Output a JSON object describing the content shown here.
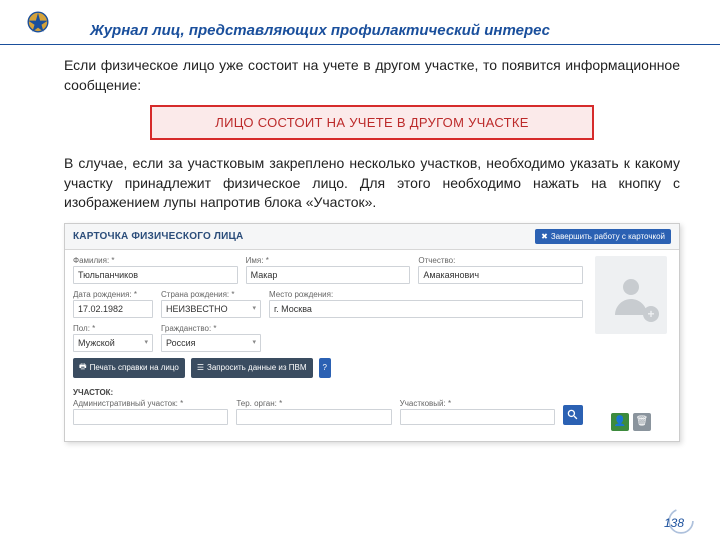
{
  "page": {
    "title": "Журнал лиц, представляющих профилактический интерес",
    "number": "138"
  },
  "paragraphs": {
    "p1": "Если физическое лицо уже состоит на учете в другом участке, то появится информационное сообщение:",
    "alert": "ЛИЦО СОСТОИТ НА УЧЕТЕ В ДРУГОМ УЧАСТКЕ",
    "p2": "В случае, если за участковым закреплено несколько участков, необходимо указать к какому участку принадлежит физическое лицо. Для этого необходимо нажать на кнопку с изображением лупы напротив блока «Участок»."
  },
  "card": {
    "header_title": "КАРТОЧКА ФИЗИЧЕСКОГО ЛИЦА",
    "close_button": "Завершить работу с карточкой",
    "labels": {
      "surname": "Фамилия: *",
      "name": "Имя: *",
      "patronymic": "Отчество:",
      "dob": "Дата рождения: *",
      "country": "Страна рождения: *",
      "birthplace": "Место рождения:",
      "sex": "Пол: *",
      "citizenship": "Гражданство: *",
      "section": "УЧАСТОК:",
      "adm": "Административный участок: *",
      "ter": "Тер. орган: *",
      "officer": "Участковый: *"
    },
    "values": {
      "surname": "Тюльпанчиков",
      "name": "Макар",
      "patronymic": "Амакаянович",
      "dob": "17.02.1982",
      "country": "НЕИЗВЕСТНО",
      "birthplace": "г. Москва",
      "sex": "Мужской",
      "citizenship": "Россия",
      "adm": "",
      "ter": "",
      "officer": ""
    },
    "buttons": {
      "print": "Печать справки на лицо",
      "fetch": "Запросить данные из ПВМ",
      "info": "?"
    }
  }
}
